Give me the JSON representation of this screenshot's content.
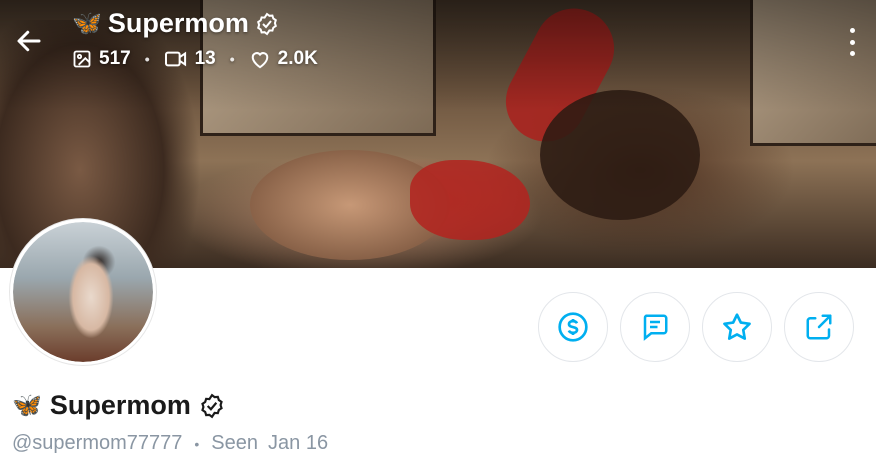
{
  "header": {
    "title_emoji": "🦋",
    "title": "Supermom",
    "stats": {
      "photos": "517",
      "videos": "13",
      "likes": "2.0K"
    }
  },
  "profile": {
    "display_emoji": "🦋",
    "display_name": "Supermom",
    "username": "@supermom77777",
    "seen_label": "Seen",
    "seen_date": "Jan 16"
  },
  "colors": {
    "accent": "#00aff0",
    "muted_text": "#8a96a3",
    "border": "#e3e6ea"
  },
  "icons": [
    "back-arrow-icon",
    "image-icon",
    "video-icon",
    "heart-icon",
    "verified-icon",
    "more-vertical-icon",
    "dollar-icon",
    "message-icon",
    "star-icon",
    "share-icon"
  ]
}
